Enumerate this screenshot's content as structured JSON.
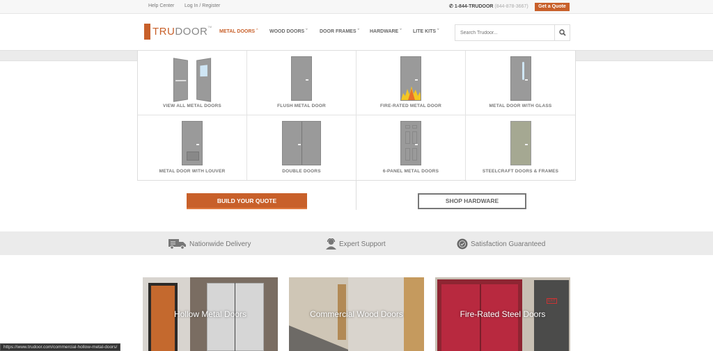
{
  "topbar": {
    "help_center": "Help Center",
    "login": "Log In / Register",
    "phone": "1-844-TRUDOOR",
    "phone_alt": "(844-878-3667)",
    "quote_button": "Get a Quote"
  },
  "brand": {
    "tru": "TRU",
    "door": "DOOR",
    "tm": "TM",
    "accent": "#c8602a"
  },
  "nav": [
    {
      "label": "METAL DOORS",
      "active": true
    },
    {
      "label": "WOOD DOORS"
    },
    {
      "label": "DOOR FRAMES"
    },
    {
      "label": "HARDWARE"
    },
    {
      "label": "LITE KITS"
    }
  ],
  "search": {
    "placeholder": "Search Trudoor..."
  },
  "mega_menu": [
    {
      "label": "VIEW ALL METAL DOORS"
    },
    {
      "label": "FLUSH METAL DOOR"
    },
    {
      "label": "FIRE-RATED METAL DOOR"
    },
    {
      "label": "METAL DOOR WITH GLASS"
    },
    {
      "label": "METAL DOOR WITH LOUVER"
    },
    {
      "label": "DOUBLE DOORS"
    },
    {
      "label": "6-PANEL METAL DOORS"
    },
    {
      "label": "STEELCRAFT DOORS & FRAMES"
    }
  ],
  "cta": {
    "build": "BUILD YOUR QUOTE",
    "shop": "SHOP HARDWARE"
  },
  "features": [
    {
      "icon": "truck-icon",
      "label": "Nationwide Delivery"
    },
    {
      "icon": "headset-icon",
      "label": "Expert Support"
    },
    {
      "icon": "badge-check-icon",
      "label": "Satisfaction Guaranteed"
    }
  ],
  "categories": [
    {
      "label": "Hollow Metal Doors"
    },
    {
      "label": "Commercial Wood Doors"
    },
    {
      "label": "Fire-Rated Steel Doors"
    }
  ],
  "status_url": "https://www.trudoor.com/commercial-hollow-metal-doors/"
}
